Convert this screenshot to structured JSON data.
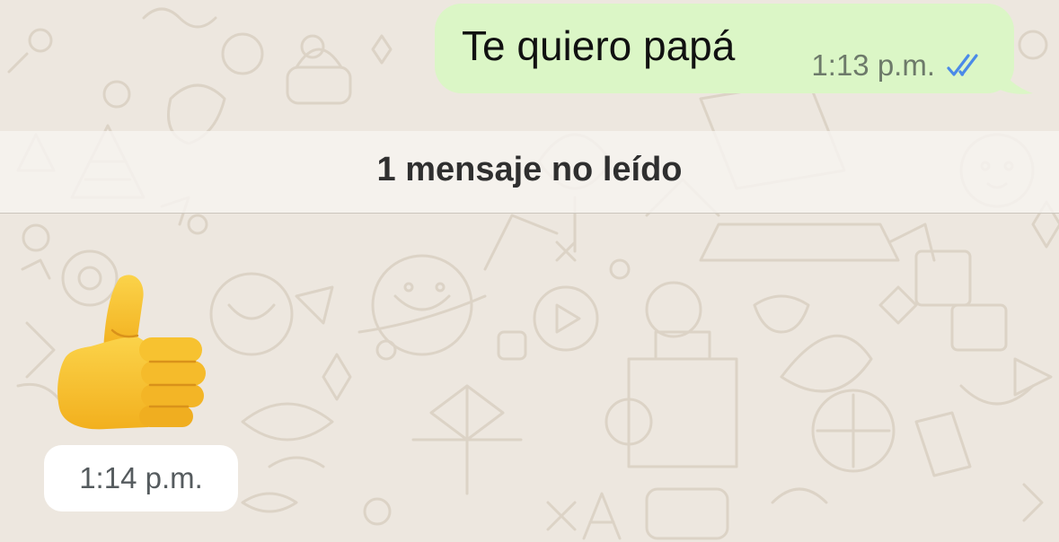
{
  "outgoing_message": {
    "text": "Te quiero papá",
    "time": "1:13 p.m.",
    "status_icon": "double-check-read-icon"
  },
  "unread_divider": {
    "label": "1 mensaje no leído"
  },
  "incoming_message": {
    "emoji_icon": "thumbs-up-emoji-icon",
    "time": "1:14 p.m."
  },
  "colors": {
    "chat_background": "#ede7df",
    "wallpaper_doodle": "#ddd5c9",
    "outgoing_bubble": "#dbf6c6",
    "read_ticks": "#4a8ae8",
    "incoming_chip": "#ffffff",
    "emoji_yellow": "#f9c631"
  }
}
